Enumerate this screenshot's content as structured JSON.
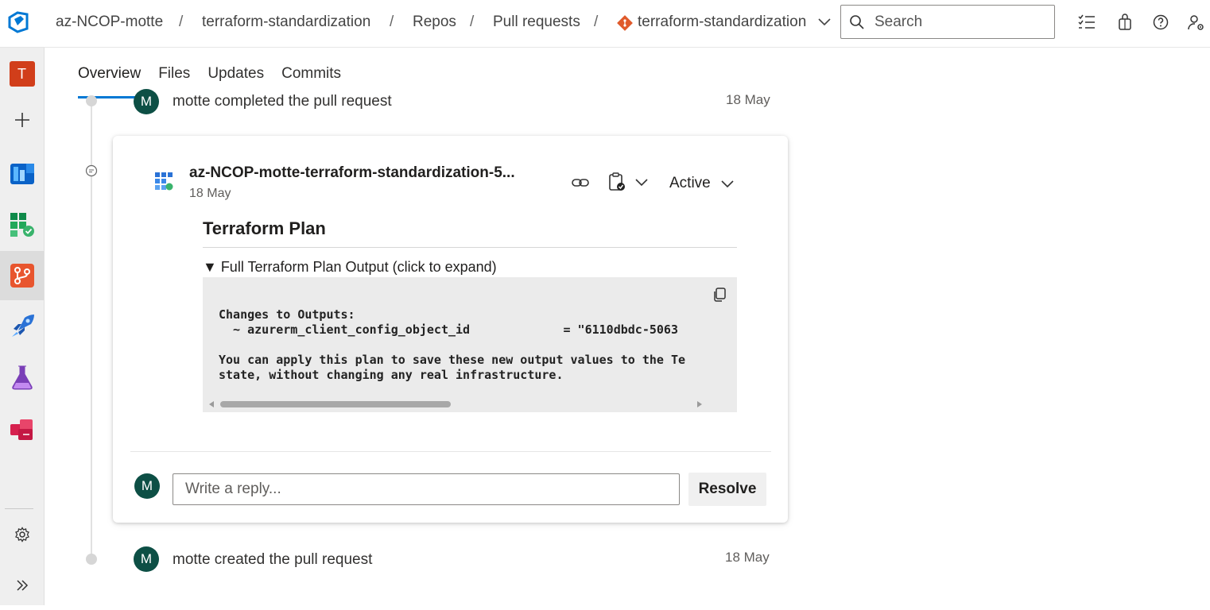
{
  "breadcrumbs": {
    "org": "az-NCOP-motte",
    "project": "terraform-standardization",
    "section": "Repos",
    "subsection": "Pull requests",
    "repo": "terraform-standardization",
    "separator": "/"
  },
  "search": {
    "placeholder": "Search"
  },
  "top_icons": [
    "task-list-icon",
    "shopping-bag-icon",
    "help-icon",
    "user-settings-icon"
  ],
  "sidebar": {
    "project_initial": "T",
    "items": [
      "add-icon",
      "boards-icon",
      "overview-icon",
      "repos-icon",
      "pipelines-icon",
      "test-plans-icon",
      "artifacts-icon"
    ],
    "bottom": [
      "settings-icon",
      "expand-icon"
    ]
  },
  "tabs": [
    {
      "label": "Overview",
      "active": true
    },
    {
      "label": "Files",
      "active": false
    },
    {
      "label": "Updates",
      "active": false
    },
    {
      "label": "Commits",
      "active": false
    }
  ],
  "timeline": {
    "completed_event": {
      "avatar": "M",
      "text": "motte completed the pull request",
      "date": "18 May"
    },
    "created_event": {
      "avatar": "M",
      "text": "motte created the pull request",
      "date": "18 May"
    }
  },
  "thread": {
    "author": "az-NCOP-motte-terraform-standardization-5...",
    "date": "18 May",
    "status": "Active",
    "plan_title": "Terraform Plan",
    "details_summary": "▼ Full Terraform Plan Output (click to expand)",
    "code": "Changes to Outputs:\n  ~ azurerm_client_config_object_id             = \"6110dbdc-5063\n\nYou can apply this plan to save these new output values to the Te\nstate, without changing any real infrastructure.",
    "reply_avatar": "M",
    "reply_placeholder": "Write a reply...",
    "resolve_label": "Resolve"
  },
  "colors": {
    "accent": "#0078d4",
    "avatar_bg": "#0d4f45",
    "project_tile": "#d13e1a"
  }
}
